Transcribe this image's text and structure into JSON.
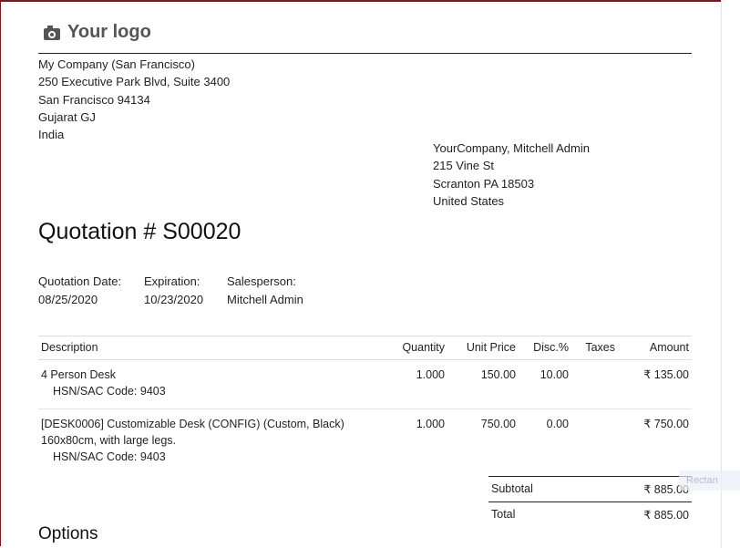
{
  "logo": {
    "text": "Your logo",
    "icon": "camera-icon"
  },
  "company": {
    "lines": [
      "My Company (San Francisco)",
      "250 Executive Park Blvd, Suite 3400",
      "San Francisco 94134",
      "Gujarat GJ",
      "India"
    ]
  },
  "partner": {
    "lines": [
      "YourCompany, Mitchell Admin",
      "215 Vine St",
      "Scranton PA 18503",
      "United States"
    ]
  },
  "title": "Quotation # S00020",
  "info": {
    "date_label": "Quotation Date:",
    "date_value": "08/25/2020",
    "expiration_label": "Expiration:",
    "expiration_value": "10/23/2020",
    "salesperson_label": "Salesperson:",
    "salesperson_value": "Mitchell Admin"
  },
  "table": {
    "headers": [
      "Description",
      "Quantity",
      "Unit Price",
      "Disc.%",
      "Taxes",
      "Amount"
    ],
    "rows": [
      {
        "desc1": "4 Person Desk",
        "desc2": "",
        "hsn": "HSN/SAC Code: 9403",
        "qty": "1.000",
        "price": "150.00",
        "disc": "10.00",
        "taxes": "",
        "amount": "₹ 135.00"
      },
      {
        "desc1": "[DESK0006] Customizable Desk (CONFIG) (Custom, Black)",
        "desc2": "160x80cm, with large legs.",
        "hsn": "HSN/SAC Code: 9403",
        "qty": "1.000",
        "price": "750.00",
        "disc": "0.00",
        "taxes": "",
        "amount": "₹ 750.00"
      }
    ]
  },
  "totals": {
    "subtotal_label": "Subtotal",
    "subtotal_value": "₹ 885.00",
    "total_label": "Total",
    "total_value": "₹ 885.00"
  },
  "options_heading": "Options",
  "ghost_tooltip": "Rectan"
}
